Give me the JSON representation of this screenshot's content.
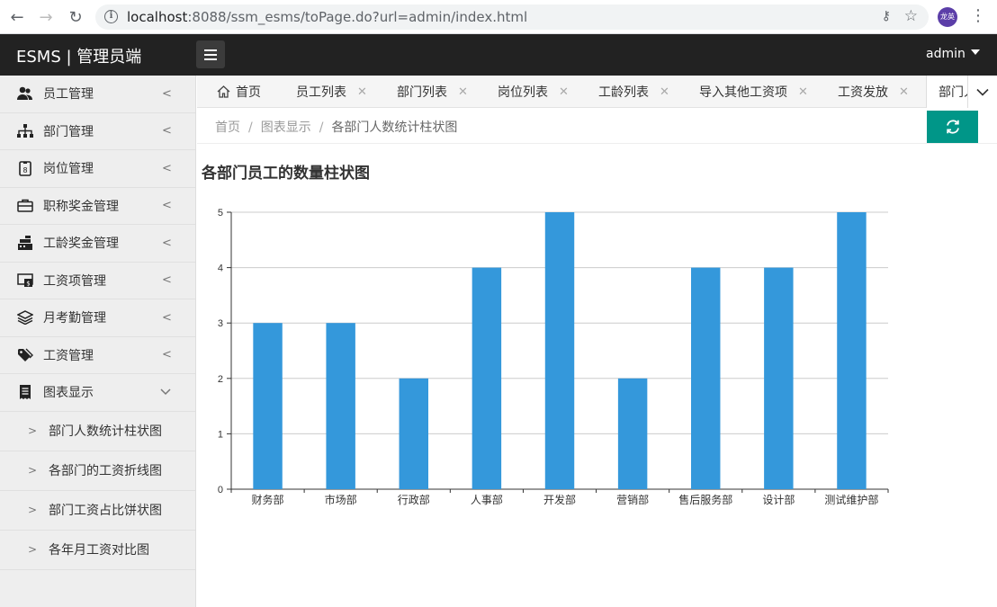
{
  "browser": {
    "url_host": "localhost",
    "url_rest": ":8088/ssm_esms/toPage.do?url=admin/index.html",
    "avatar_text": "龙英"
  },
  "header": {
    "title": "ESMS | 管理员端",
    "user": "admin"
  },
  "sidebar": {
    "items": [
      {
        "label": "员工管理",
        "icon": "users-icon"
      },
      {
        "label": "部门管理",
        "icon": "sitemap-icon"
      },
      {
        "label": "岗位管理",
        "icon": "id-badge-icon"
      },
      {
        "label": "职称奖金管理",
        "icon": "briefcase-icon"
      },
      {
        "label": "工龄奖金管理",
        "icon": "cash-register-icon"
      },
      {
        "label": "工资项管理",
        "icon": "money-bill-icon"
      },
      {
        "label": "月考勤管理",
        "icon": "layers-icon"
      },
      {
        "label": "工资管理",
        "icon": "tags-icon"
      },
      {
        "label": "图表显示",
        "icon": "receipt-icon"
      }
    ],
    "subitems": [
      "部门人数统计柱状图",
      "各部门的工资折线图",
      "部门工资占比饼状图",
      "各年月工资对比图"
    ]
  },
  "tabs": {
    "home": "首页",
    "items": [
      "员工列表",
      "部门列表",
      "岗位列表",
      "工龄列表",
      "导入其他工资项",
      "工资发放"
    ],
    "active": "部门人"
  },
  "breadcrumb": {
    "home": "首页",
    "section": "图表显示",
    "current": "各部门人数统计柱状图"
  },
  "colors": {
    "accent": "#009688",
    "bar": "#3498db",
    "header_bg": "#222222"
  },
  "chart_data": {
    "type": "bar",
    "title": "各部门员工的数量柱状图",
    "categories": [
      "财务部",
      "市场部",
      "行政部",
      "人事部",
      "开发部",
      "营销部",
      "售后服务部",
      "设计部",
      "测试维护部"
    ],
    "values": [
      3,
      3,
      2,
      4,
      5,
      2,
      4,
      4,
      5
    ],
    "ylim": [
      0,
      5
    ],
    "yticks": [
      0,
      1,
      2,
      3,
      4,
      5
    ],
    "xlabel": "",
    "ylabel": "",
    "grid": true
  }
}
